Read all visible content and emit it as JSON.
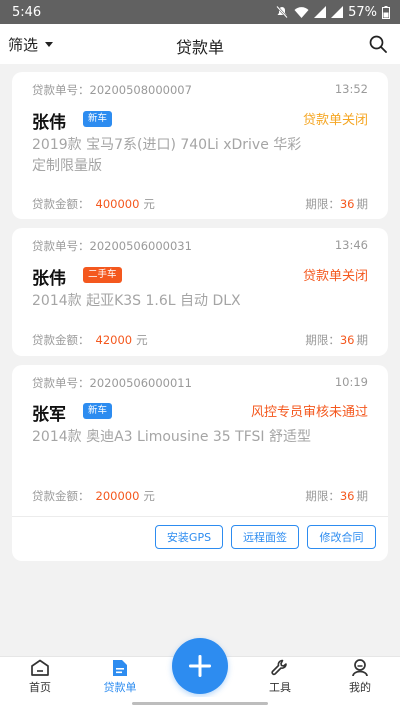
{
  "status_bar": {
    "time": "5:46",
    "battery": "57%"
  },
  "nav": {
    "filter_label": "筛选",
    "title": "贷款单"
  },
  "labels": {
    "order_no": "贷款单号：",
    "amount": "贷款金额：",
    "currency": "元",
    "period": "期限：",
    "period_unit": "期"
  },
  "loans": [
    {
      "order_no": "20200508000007",
      "time": "13:52",
      "name": "张伟",
      "tag": "新车",
      "status": "贷款单关闭",
      "model": "2019款 宝马7系(进口) 740Li xDrive 华彩定制限量版",
      "amount": "400000",
      "period": "36"
    },
    {
      "order_no": "20200506000031",
      "time": "13:46",
      "name": "张伟",
      "tag": "二手车",
      "status": "贷款单关闭",
      "model": "2014款 起亚K3S 1.6L 自动 DLX",
      "amount": "42000",
      "period": "36"
    },
    {
      "order_no": "20200506000011",
      "time": "10:19",
      "name": "张军",
      "tag": "新车",
      "status": "风控专员审核未通过",
      "model": "2014款 奥迪A3 Limousine 35 TFSI 舒适型",
      "amount": "200000",
      "period": "36",
      "actions": [
        "安装GPS",
        "远程面签",
        "修改合同"
      ]
    }
  ],
  "tabs": [
    "首页",
    "贷款单",
    "工具",
    "我的"
  ],
  "colors": {
    "accent": "#2d8cf0",
    "orange": "#f4581e",
    "closed_status": "#f5a623",
    "red_status": "#f4581e"
  }
}
